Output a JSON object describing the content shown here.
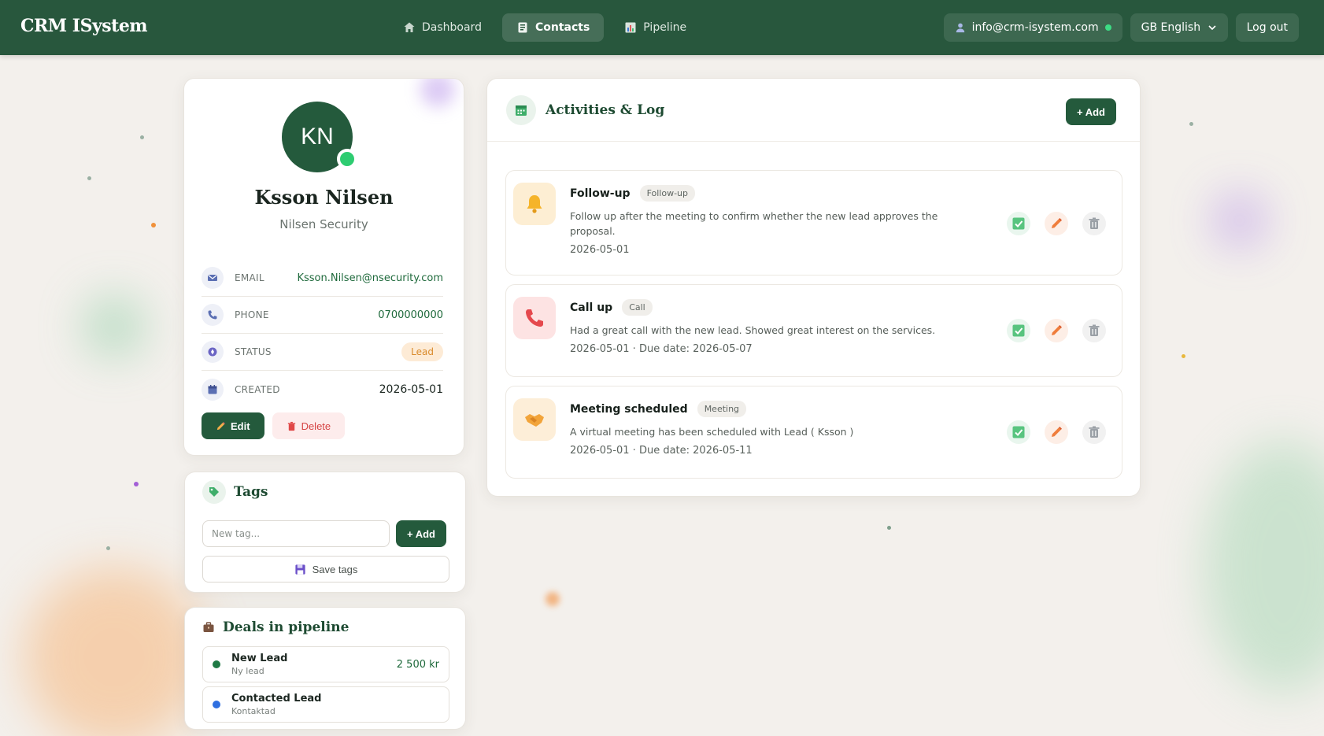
{
  "app": {
    "brand": "CRM ISystem"
  },
  "nav": {
    "links": [
      {
        "label": "Dashboard",
        "icon": "home-icon"
      },
      {
        "label": "Contacts",
        "icon": "contacts-icon",
        "active": true
      },
      {
        "label": "Pipeline",
        "icon": "chart-icon"
      }
    ],
    "user_email": "info@crm-isystem.com",
    "language": "GB English",
    "logout": "Log out"
  },
  "contact": {
    "initials": "KN",
    "name": "Ksson Nilsen",
    "company": "Nilsen Security",
    "fields": [
      {
        "label": "EMAIL",
        "value": "Ksson.Nilsen@nsecurity.com",
        "icon": "mail-icon"
      },
      {
        "label": "PHONE",
        "value": "0700000000",
        "icon": "phone-icon"
      },
      {
        "label": "STATUS",
        "value": "Lead",
        "icon": "status-icon"
      },
      {
        "label": "CREATED",
        "value": "2026-05-01",
        "icon": "calendar-icon"
      }
    ],
    "edit_label": "Edit",
    "delete_label": "Delete"
  },
  "tags": {
    "title": "Tags",
    "placeholder": "New tag...",
    "add_label": "+ Add",
    "save_label": "Save tags"
  },
  "deals": {
    "title": "Deals in pipeline",
    "items": [
      {
        "title": "New Lead",
        "subtitle": "Ny lead",
        "amount": "2 500 kr",
        "color": "#1f7a45"
      },
      {
        "title": "Contacted Lead",
        "subtitle": "Kontaktad",
        "amount": "",
        "color": "#2f6fe0"
      }
    ]
  },
  "activities": {
    "title": "Activities & Log",
    "add_label": "+ Add",
    "items": [
      {
        "name": "Follow-up",
        "type": "Follow-up",
        "description": "Follow up after the meeting to confirm whether the new lead approves the proposal.",
        "date": "2026-05-01",
        "icon": "bell-icon"
      },
      {
        "name": "Call up",
        "type": "Call",
        "description": "Had a great call with the new lead. Showed great interest on the services.",
        "date": "2026-05-01 · Due date: 2026-05-07",
        "icon": "phone-call-icon"
      },
      {
        "name": "Meeting scheduled",
        "type": "Meeting",
        "description": "A virtual meeting has been scheduled with Lead ( Ksson )",
        "date": "2026-05-01 · Due date: 2026-05-11",
        "icon": "handshake-icon"
      }
    ]
  },
  "colors": {
    "navbar": "#28573d",
    "primary": "#245a3c",
    "lead_badge": "#fdebd6",
    "danger": "#d64545"
  }
}
